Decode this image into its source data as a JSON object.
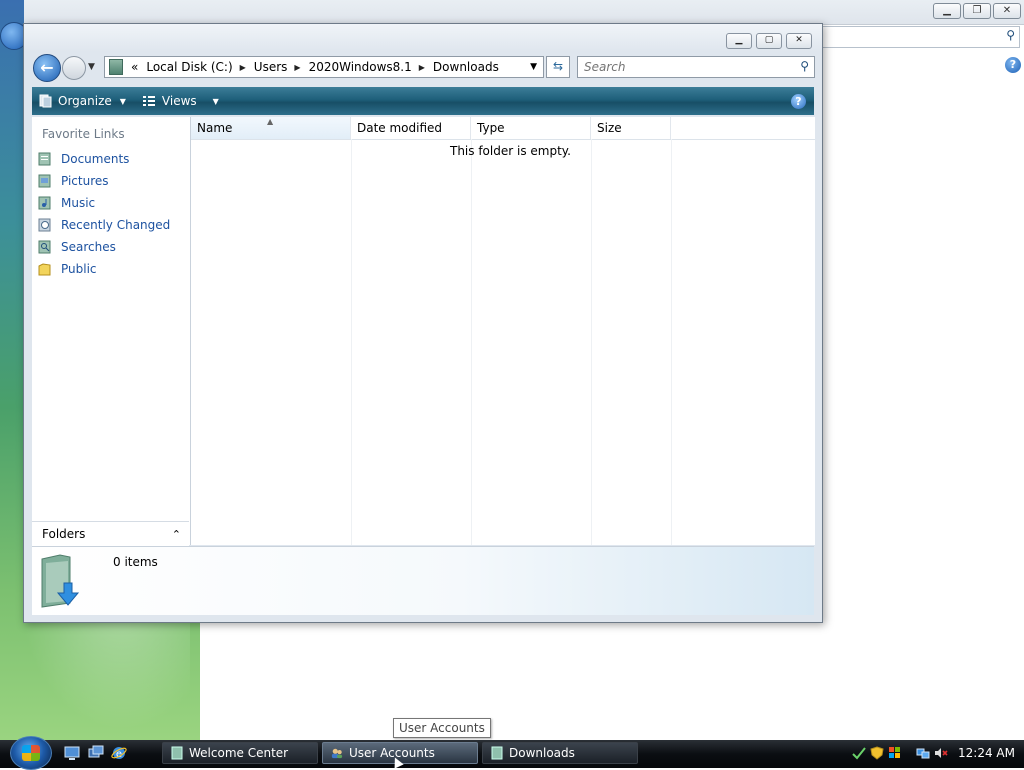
{
  "explorer": {
    "address": {
      "overflow": "«",
      "crumbs": [
        "Local Disk (C:)",
        "Users",
        "2020Windows8.1",
        "Downloads"
      ]
    },
    "search_placeholder": "Search",
    "toolbar": {
      "organize": "Organize",
      "views": "Views"
    },
    "left_pane": {
      "heading": "Favorite Links",
      "links": [
        "Documents",
        "Pictures",
        "Music",
        "Recently Changed",
        "Searches",
        "Public"
      ],
      "folders_label": "Folders"
    },
    "columns": [
      "Name",
      "Date modified",
      "Type",
      "Size"
    ],
    "empty_message": "This folder is empty.",
    "details": {
      "item_count": "0 items"
    }
  },
  "tooltip": "User Accounts",
  "taskbar": {
    "tasks": [
      "Welcome Center",
      "User Accounts",
      "Downloads"
    ],
    "active_task": "User Accounts",
    "clock": "12:24 AM"
  },
  "colors": {
    "toolbar": "#1e5f7a",
    "link": "#1d52a0",
    "taskbar": "#0b0e12"
  }
}
